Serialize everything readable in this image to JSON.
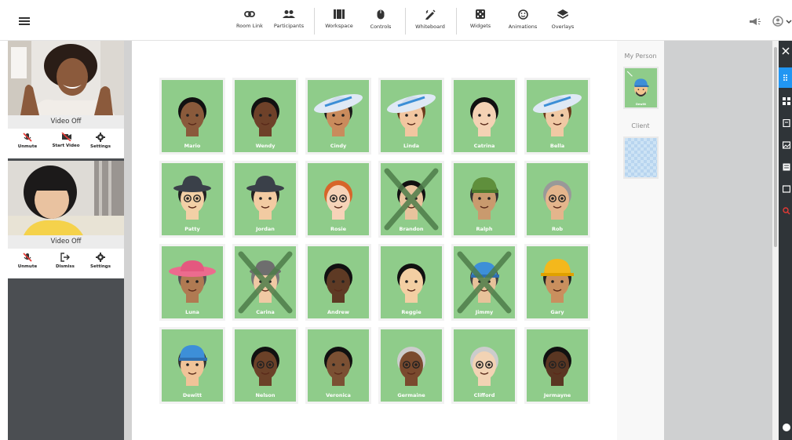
{
  "toolbar": {
    "items": [
      {
        "label": "Room Link",
        "icon": "link-icon"
      },
      {
        "label": "Participants",
        "icon": "participants-icon"
      },
      {
        "label": "Workspace",
        "icon": "workspace-icon"
      },
      {
        "label": "Controls",
        "icon": "mouse-icon"
      },
      {
        "label": "Whiteboard",
        "icon": "whiteboard-icon"
      },
      {
        "label": "Widgets",
        "icon": "dice-icon"
      },
      {
        "label": "Animations",
        "icon": "smiley-icon"
      },
      {
        "label": "Overlays",
        "icon": "layers-icon"
      }
    ]
  },
  "videos": [
    {
      "status": "Video Off",
      "controls": [
        {
          "label": "Unmute"
        },
        {
          "label": "Start Video"
        },
        {
          "label": "Settings"
        }
      ]
    },
    {
      "status": "Video Off",
      "controls": [
        {
          "label": "Unmute"
        },
        {
          "label": "Dismiss"
        },
        {
          "label": "Settings"
        }
      ]
    }
  ],
  "characters": [
    {
      "name": "Mario"
    },
    {
      "name": "Wendy"
    },
    {
      "name": "Cindy"
    },
    {
      "name": "Linda"
    },
    {
      "name": "Catrina"
    },
    {
      "name": "Bella"
    },
    {
      "name": "Patty"
    },
    {
      "name": "Jordan"
    },
    {
      "name": "Rosie"
    },
    {
      "name": "Brandon",
      "crossed": true
    },
    {
      "name": "Ralph"
    },
    {
      "name": "Rob"
    },
    {
      "name": "Luna"
    },
    {
      "name": "Carina",
      "crossed": true
    },
    {
      "name": "Andrew"
    },
    {
      "name": "Reggie"
    },
    {
      "name": "Jimmy",
      "crossed": true
    },
    {
      "name": "Gary"
    },
    {
      "name": "Dewitt"
    },
    {
      "name": "Nelson"
    },
    {
      "name": "Veronica"
    },
    {
      "name": "Germaine"
    },
    {
      "name": "Clifford"
    },
    {
      "name": "Jermayne"
    }
  ],
  "side_panel": {
    "my_person_label": "My Person",
    "my_person_name": "Dewitt",
    "client_label": "Client"
  },
  "colors": {
    "card_bg": "#8fcc8a",
    "accent": "#2196f3"
  }
}
